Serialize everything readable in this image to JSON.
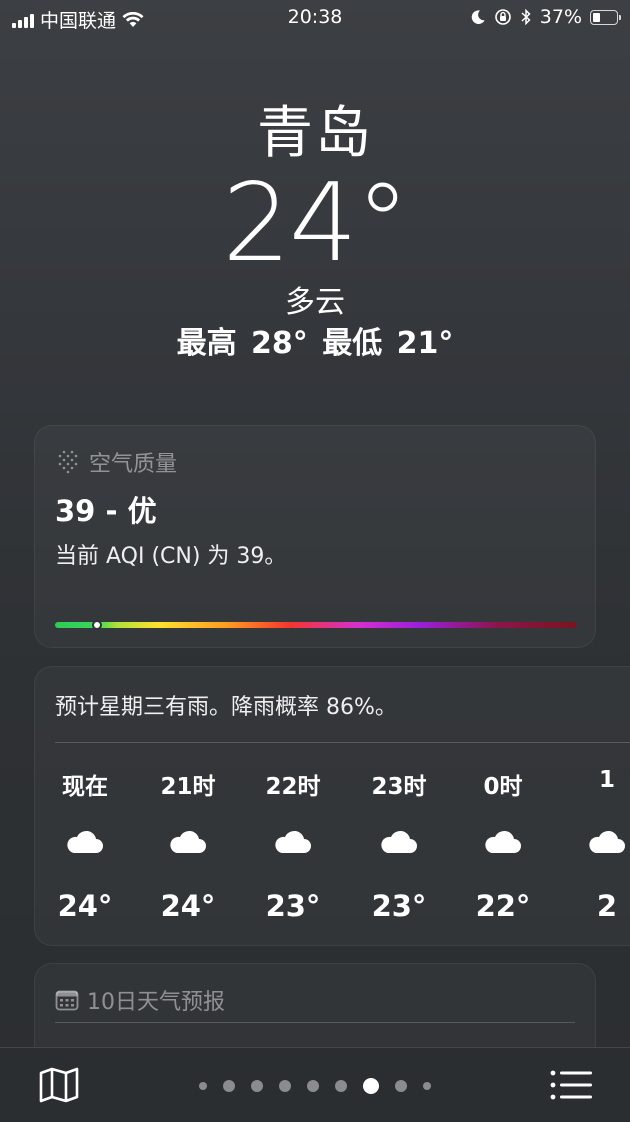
{
  "status_bar": {
    "carrier": "中国联通",
    "time": "20:38",
    "battery_percent": "37%",
    "battery_level": 0.37,
    "icons": [
      "signal-icon",
      "wifi-icon",
      "moon-icon",
      "orientation-lock-icon",
      "bluetooth-icon",
      "battery-icon"
    ]
  },
  "hero": {
    "city": "青岛",
    "temperature": "24°",
    "condition": "多云",
    "hilo": "最高 28°  最低 21°"
  },
  "aqi_card": {
    "title": "空气质量",
    "value": "39 - 优",
    "description": "当前 AQI (CN) 为 39。",
    "marker_fraction": 0.08
  },
  "hourly_card": {
    "summary": "预计星期三有雨。降雨概率 86%。",
    "hours": [
      {
        "label": "现在",
        "icon": "cloud-icon",
        "temp": "24°"
      },
      {
        "label": "21时",
        "icon": "cloud-icon",
        "temp": "24°"
      },
      {
        "label": "22时",
        "icon": "cloud-icon",
        "temp": "23°"
      },
      {
        "label": "23时",
        "icon": "cloud-icon",
        "temp": "23°"
      },
      {
        "label": "0时",
        "icon": "cloud-icon",
        "temp": "22°"
      },
      {
        "label": "1",
        "icon": "cloud-icon",
        "temp": "2"
      }
    ]
  },
  "forecast_card": {
    "title": "10日天气预报"
  },
  "toolbar": {
    "page_count": 9,
    "active_page": 7,
    "icons": [
      "map-icon",
      "list-icon"
    ]
  },
  "colors": {
    "background": "#34373b",
    "aqi_good": "#2ecc55"
  }
}
